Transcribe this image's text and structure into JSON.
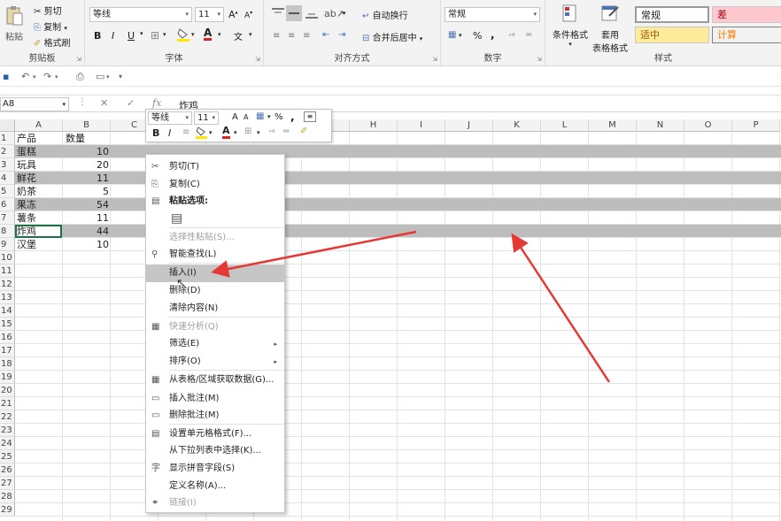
{
  "ribbon": {
    "clipboard": {
      "paste": "粘贴",
      "cut": "剪切",
      "copy": "复制",
      "format_painter": "格式刷",
      "label": "剪贴板"
    },
    "font": {
      "name": "等线",
      "size": "11",
      "bold": "B",
      "italic": "I",
      "underline": "U",
      "font_color_letter": "A",
      "wen": "文",
      "grow": "A",
      "shrink": "A",
      "label": "字体"
    },
    "align": {
      "wrap": "自动换行",
      "merge": "合并后居中",
      "label": "对齐方式"
    },
    "number": {
      "format": "常规",
      "pct": "%",
      "comma": ",",
      "label": "数字"
    },
    "styles": {
      "conditional": "条件格式",
      "table_line1": "套用",
      "table_line2": "表格格式",
      "normal": "常规",
      "bad": "差",
      "neutral": "适中",
      "calc": "计算",
      "label": "样式"
    }
  },
  "namebox": "A8",
  "formula": "炸鸡",
  "fx": "fx",
  "columns": [
    "A",
    "B",
    "C",
    "D",
    "E",
    "F",
    "G",
    "H",
    "I",
    "J",
    "K",
    "L",
    "M",
    "N",
    "O",
    "P"
  ],
  "rows": [
    {
      "n": "1",
      "a": "产品",
      "b": "数量"
    },
    {
      "n": "2",
      "a": "蛋糕",
      "b": "10"
    },
    {
      "n": "3",
      "a": "玩具",
      "b": "20"
    },
    {
      "n": "4",
      "a": "鲜花",
      "b": "11"
    },
    {
      "n": "5",
      "a": "奶茶",
      "b": "5"
    },
    {
      "n": "6",
      "a": "果冻",
      "b": "54"
    },
    {
      "n": "7",
      "a": "薯条",
      "b": "11"
    },
    {
      "n": "8",
      "a": "炸鸡",
      "b": "44"
    },
    {
      "n": "9",
      "a": "汉堡",
      "b": "10"
    },
    {
      "n": "10",
      "a": "",
      "b": ""
    },
    {
      "n": "11",
      "a": "",
      "b": ""
    },
    {
      "n": "12",
      "a": "",
      "b": ""
    },
    {
      "n": "13",
      "a": "",
      "b": ""
    },
    {
      "n": "14",
      "a": "",
      "b": ""
    },
    {
      "n": "15",
      "a": "",
      "b": ""
    },
    {
      "n": "16",
      "a": "",
      "b": ""
    },
    {
      "n": "17",
      "a": "",
      "b": ""
    },
    {
      "n": "18",
      "a": "",
      "b": ""
    },
    {
      "n": "19",
      "a": "",
      "b": ""
    },
    {
      "n": "20",
      "a": "",
      "b": ""
    },
    {
      "n": "21",
      "a": "",
      "b": ""
    },
    {
      "n": "22",
      "a": "",
      "b": ""
    },
    {
      "n": "23",
      "a": "",
      "b": ""
    },
    {
      "n": "24",
      "a": "",
      "b": ""
    },
    {
      "n": "25",
      "a": "",
      "b": ""
    },
    {
      "n": "26",
      "a": "",
      "b": ""
    },
    {
      "n": "27",
      "a": "",
      "b": ""
    },
    {
      "n": "28",
      "a": "",
      "b": ""
    },
    {
      "n": "29",
      "a": "",
      "b": ""
    }
  ],
  "mini_toolbar": {
    "font": "等线",
    "size": "11",
    "bold": "B",
    "italic": "I",
    "pct": "%",
    "comma": ",",
    "grow": "A",
    "shrink": "A"
  },
  "menu": [
    {
      "label": "剪切(T)",
      "icon": "scissors-icon",
      "glyph": "✂"
    },
    {
      "label": "复制(C)",
      "icon": "copy-icon",
      "glyph": "⎘"
    },
    {
      "label": "粘贴选项:",
      "icon": "clipboard-icon",
      "glyph": "▤",
      "bold": true
    },
    {
      "label": "",
      "icon": "paste-icon",
      "glyph": "▤",
      "paste_box": true
    },
    {
      "label": "选择性粘贴(S)...",
      "disabled": true
    },
    {
      "label": "智能查找(L)",
      "icon": "search-icon",
      "glyph": "⚲"
    },
    {
      "label": "插入(I)",
      "highlight": true
    },
    {
      "label": "删除(D)"
    },
    {
      "label": "清除内容(N)"
    },
    {
      "label": "快速分析(Q)",
      "icon": "quick-analysis-icon",
      "glyph": "▦",
      "disabled": true
    },
    {
      "label": "筛选(E)",
      "submenu": true
    },
    {
      "label": "排序(O)",
      "submenu": true
    },
    {
      "label": "从表格/区域获取数据(G)...",
      "icon": "table-icon",
      "glyph": "▦"
    },
    {
      "label": "插入批注(M)",
      "icon": "comment-icon",
      "glyph": "▭"
    },
    {
      "label": "删除批注(M)",
      "icon": "delete-comment-icon",
      "glyph": "▭"
    },
    {
      "label": "设置单元格格式(F)...",
      "icon": "format-cells-icon",
      "glyph": "▤"
    },
    {
      "label": "从下拉列表中选择(K)..."
    },
    {
      "label": "显示拼音字段(S)",
      "icon": "phonetic-icon",
      "glyph": "字"
    },
    {
      "label": "定义名称(A)..."
    },
    {
      "label": "链接(I)",
      "icon": "link-icon",
      "glyph": "⚭",
      "disabled": true
    }
  ]
}
